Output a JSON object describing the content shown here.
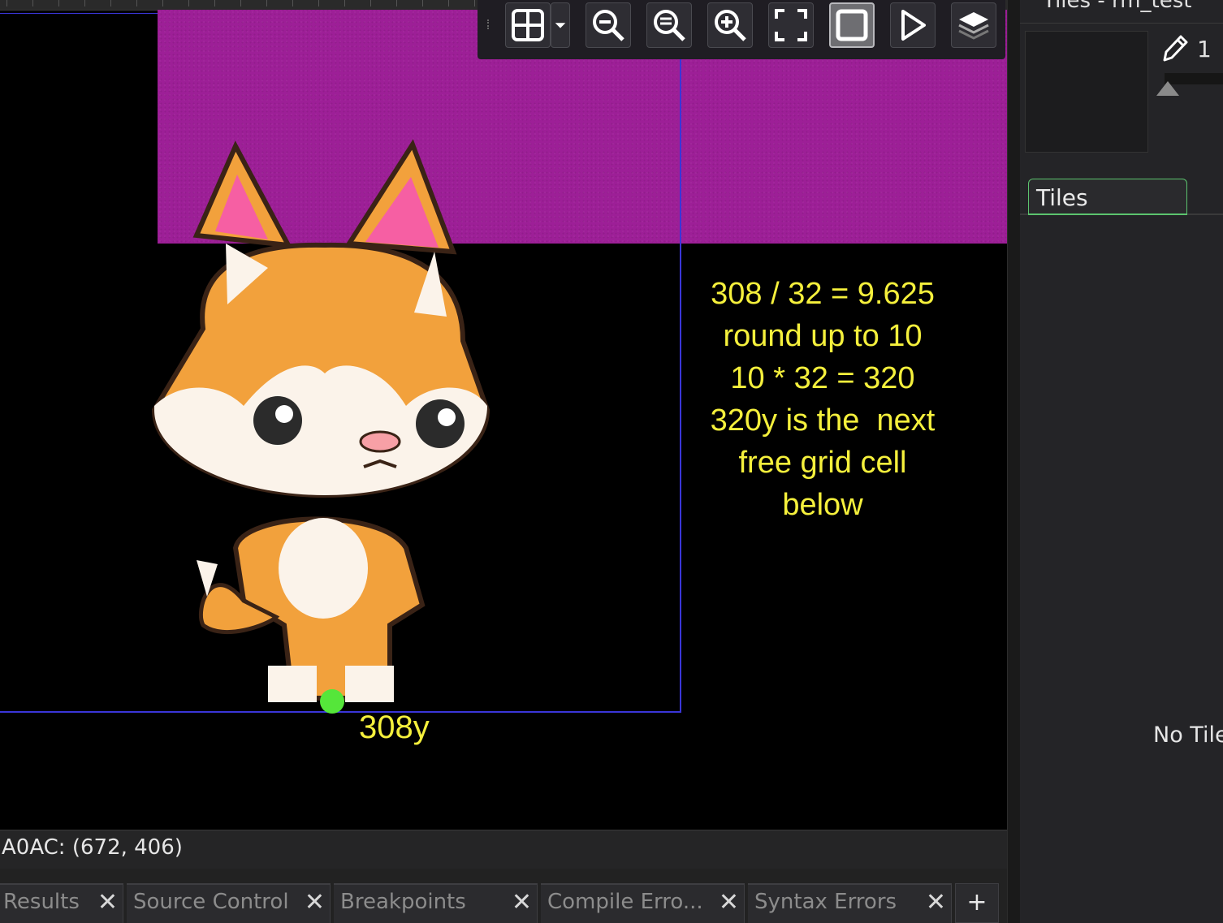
{
  "toolbar": {
    "buttons": [
      {
        "name": "grid-toggle-button",
        "icon": "grid-icon"
      },
      {
        "name": "zoom-out-button",
        "icon": "zoom-out-icon"
      },
      {
        "name": "zoom-reset-button",
        "icon": "zoom-reset-icon"
      },
      {
        "name": "zoom-in-button",
        "icon": "zoom-in-icon"
      },
      {
        "name": "fit-screen-button",
        "icon": "fullscreen-icon"
      },
      {
        "name": "frame-view-button",
        "icon": "frame-icon",
        "active": true
      },
      {
        "name": "play-button",
        "icon": "play-icon"
      },
      {
        "name": "layers-button",
        "icon": "layers-icon"
      }
    ]
  },
  "annotation": {
    "lines": [
      "308 / 32 = 9.625",
      "round up to 10",
      "10 * 32 = 320",
      "",
      "320y is the  next",
      "free grid cell",
      "below"
    ],
    "y_label": "308y"
  },
  "status": {
    "text": "A0AC: (672, 406)"
  },
  "bottom_tabs": [
    {
      "label": "Results"
    },
    {
      "label": "Source Control"
    },
    {
      "label": "Breakpoints"
    },
    {
      "label": "Compile Erro..."
    },
    {
      "label": "Syntax Errors"
    }
  ],
  "bottom_add": "+",
  "right_panel": {
    "title": "Tiles - rm_test",
    "brush_size": "1",
    "tab_label": "Tiles",
    "empty_text": "No Tile"
  },
  "colors": {
    "room_background": "#9d1f97",
    "annotation_text": "#f5f03c",
    "origin_dot": "#55e63a",
    "room_bounds": "#3a35d8",
    "tab_accent": "#5cc46e"
  }
}
